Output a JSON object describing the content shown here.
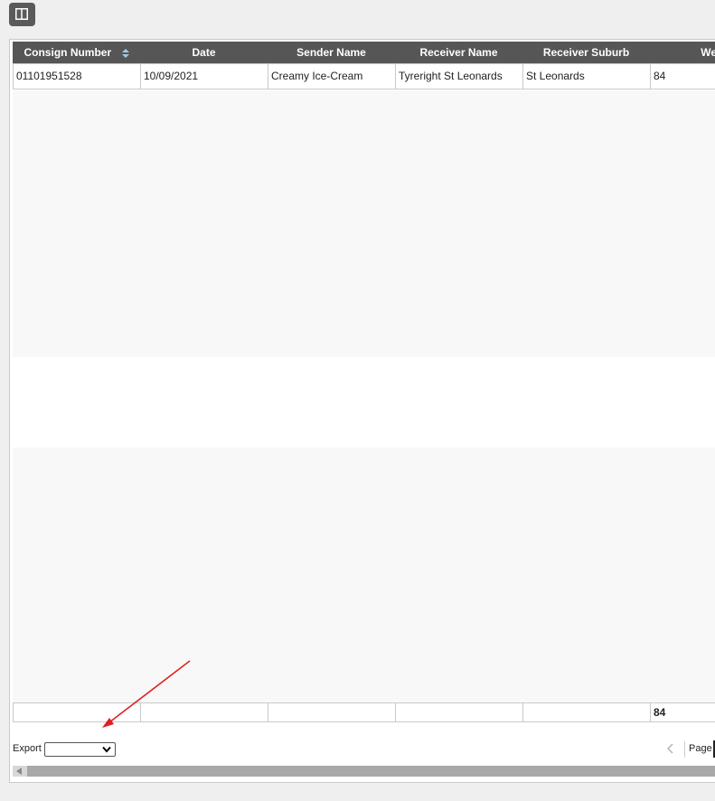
{
  "toolbar": {
    "panel_toggle_icon": "panel-columns-icon"
  },
  "grid": {
    "columns": [
      {
        "label": "Consign Number",
        "sorted": true
      },
      {
        "label": "Date"
      },
      {
        "label": "Sender Name"
      },
      {
        "label": "Receiver Name"
      },
      {
        "label": "Receiver Suburb"
      },
      {
        "label": "Weig"
      }
    ],
    "rows": [
      [
        "01101951528",
        "10/09/2021",
        "Creamy Ice-Cream",
        "Tyreright St Leonards",
        "St Leonards",
        "84"
      ]
    ],
    "footer": [
      "",
      "",
      "",
      "",
      "",
      "84"
    ]
  },
  "export": {
    "label": "Export",
    "selected": ""
  },
  "pager": {
    "page_label": "Page"
  },
  "colors": {
    "header_bg": "#565656",
    "annotation_arrow": "#e02020"
  }
}
